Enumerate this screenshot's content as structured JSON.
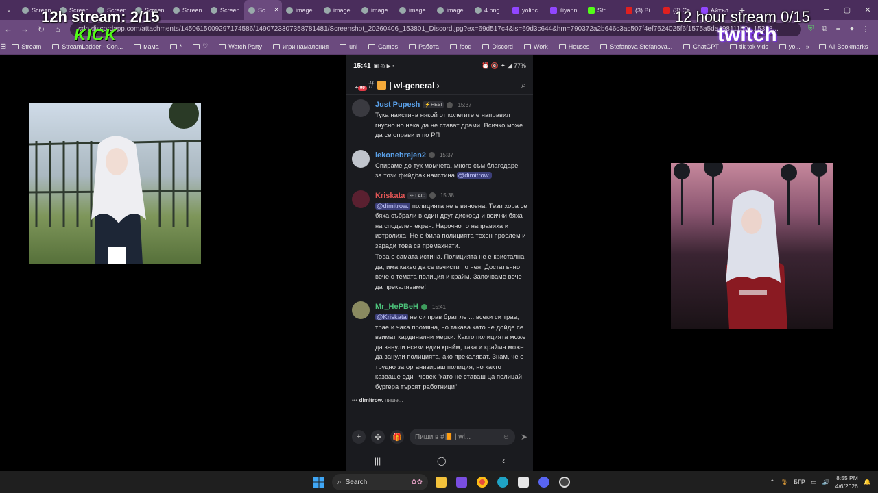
{
  "browser": {
    "tabs": [
      {
        "label": "Screen",
        "icon": "globe"
      },
      {
        "label": "Screen",
        "icon": "globe"
      },
      {
        "label": "Screen",
        "icon": "globe"
      },
      {
        "label": "Screen",
        "icon": "globe"
      },
      {
        "label": "Screen",
        "icon": "globe"
      },
      {
        "label": "Screen",
        "icon": "globe"
      },
      {
        "label": "Sc",
        "icon": "globe",
        "active": true
      },
      {
        "label": "image",
        "icon": "globe"
      },
      {
        "label": "image",
        "icon": "globe"
      },
      {
        "label": "image",
        "icon": "globe"
      },
      {
        "label": "image",
        "icon": "globe"
      },
      {
        "label": "image",
        "icon": "globe"
      },
      {
        "label": "4.png",
        "icon": "globe"
      },
      {
        "label": "yolinc",
        "icon": "twitch"
      },
      {
        "label": "iliyann",
        "icon": "twitch"
      },
      {
        "label": "Str",
        "icon": "kick"
      },
      {
        "label": "(3) Bi",
        "icon": "youtube"
      },
      {
        "label": "(3) Ce",
        "icon": "youtube"
      },
      {
        "label": "Айтъл",
        "icon": "twitch"
      }
    ],
    "url": "cdn.discordapp.com/attachments/1450615009297174586/1490723307358781481/Screenshot_20260406_153801_Discord.jpg?ex=69d517c4&is=69d3c644&hm=790372a2b646c3ac507f4ef7624025f6f1575a5da498111b0...15328...",
    "bookmarks": [
      "Stream",
      "StreamLadder - Con...",
      "мама",
      "*",
      "♡",
      "Watch Party",
      "игри намаления",
      "uni",
      "Games",
      "Работа",
      "food",
      "Discord",
      "Work",
      "Houses",
      "Stefanova Stefanova...",
      "ChatGPT",
      "tik tok vids",
      "yo..."
    ],
    "all_bookmarks": "All Bookmarks"
  },
  "overlay": {
    "left_title": "12h stream: 2/15",
    "left_logo": "KICK",
    "right_title": "12 hour stream 0/15",
    "right_logo": "twitch"
  },
  "phone": {
    "status_time": "15:41",
    "status_battery": "77%",
    "channel": "wl-general",
    "unread_badge": "99",
    "messages": [
      {
        "author": "Just Pupesh",
        "author_color": "#5aa0e8",
        "tag": "⚡HESI",
        "time": "15:37",
        "avatar_color": "#3a3a40",
        "texts": [
          "Тука наистина някой от колегите е направил гнусно но нека да не стават драми. Всичко може да се оправи и по РП"
        ]
      },
      {
        "author": "lekonebrejen2",
        "author_color": "#5aa0e8",
        "time": "15:37",
        "avatar_color": "#c0c4cc",
        "texts_html": true,
        "texts": [
          "Спираме до тук момчета, много съм благодарен за този фийдбак наистина"
        ],
        "mention_after": "@dimitrow."
      },
      {
        "author": "Kriskata",
        "author_color": "#e05555",
        "tag": "✈ LAC",
        "time": "15:38",
        "avatar_color": "#5a2030",
        "mention_before": "@dimitrow.",
        "texts": [
          "полицията не е виновна. Тези хора се бяха събрали в един друг дискорд и всички бяха на споделен екран. Нарочно го направиха и изтролиха! Не е била полицията техен проблем и заради това са премахнати.",
          "Това е самата истина. Полицията не е кристална да, има какво да се изчисти по нея. Достатъчно вече с темата полиция и крайм. Започваме вече да прекаляваме!"
        ]
      },
      {
        "author": "Mr_НеРВеН",
        "author_color": "#4cc27a",
        "time": "15:41",
        "avatar_color": "#8a8a60",
        "mention_before": "@Kriskata",
        "texts": [
          "не си прав брат ле ... всеки си трае, трае и чака промяна, но такава като не дойде се взимат кардинални мерки. Както полицията може да занули всеки един крайм, така и крайма може да занули полицията, ако прекаляват. Знам, че е трудно за организираш полиция, но както казваше един човек \"като не ставаш ца полицай бургера търсят работници\""
        ]
      }
    ],
    "typing_user": "dimitrow.",
    "typing_suffix": "пише...",
    "composer_placeholder": "Пиши в #📙 | wl..."
  },
  "taskbar": {
    "search_label": "Search",
    "language": "БГР",
    "time": "8:55 PM",
    "date": "4/6/2026"
  }
}
